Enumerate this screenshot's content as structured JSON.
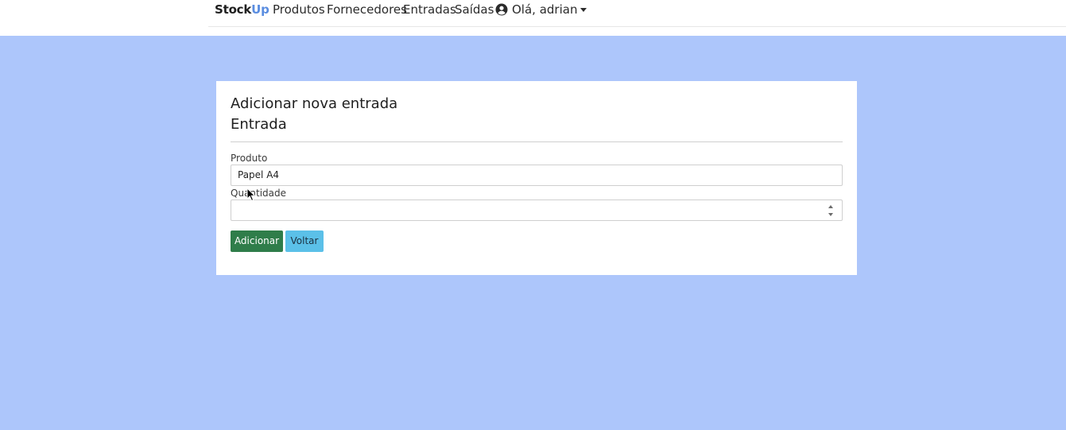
{
  "navbar": {
    "brand_part1": "Stock",
    "brand_part2": "Up",
    "links": [
      "Produtos",
      "Fornecedores",
      "Entradas",
      "Saídas"
    ],
    "user_greeting": "Olá, adrian",
    "user_icon": "user-circle-icon",
    "dropdown_icon": "caret-down-icon"
  },
  "form": {
    "title": "Adicionar nova entrada",
    "subtitle": "Entrada",
    "produto_label": "Produto",
    "produto_value": "Papel A4",
    "quantidade_label": "Quantidade",
    "quantidade_value": "",
    "submit_label": "Adicionar",
    "back_label": "Voltar"
  },
  "colors": {
    "page_background": "#adc6fb",
    "brand_accent": "#5a8de0",
    "submit_button": "#2f7d4a",
    "back_button": "#5bc0e8"
  }
}
